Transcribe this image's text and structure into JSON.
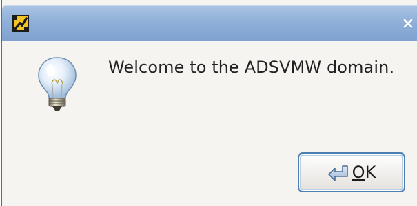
{
  "window": {
    "title": "",
    "app_icon": "app-logo-icon",
    "close_icon": "close-icon"
  },
  "dialog": {
    "icon": "lightbulb-icon",
    "message": "Welcome to the ADSVMW domain.",
    "ok_button": {
      "mnemonic": "O",
      "rest": "K",
      "icon": "return-arrow-icon"
    }
  },
  "colors": {
    "titlebar": "#90b0d8",
    "background": "#f6f4f1",
    "button_border": "#4c7fb4"
  }
}
